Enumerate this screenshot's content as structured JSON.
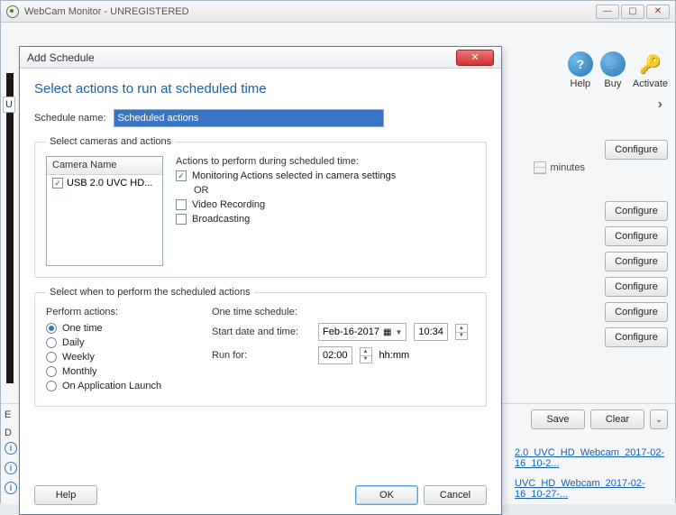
{
  "window": {
    "title": "WebCam Monitor - UNREGISTERED"
  },
  "toolbar": {
    "help": "Help",
    "buy": "Buy",
    "activate": "Activate"
  },
  "background": {
    "minutes_label": "minutes",
    "configure_label": "Configure",
    "save_label": "Save",
    "clear_label": "Clear",
    "file_link_1": "2.0_UVC_HD_Webcam_2017-02-16_10-2...",
    "file_link_2": "UVC_HD_Webcam_2017-02-16_10-27-...",
    "left_E": "E",
    "left_D": "D",
    "left_U": "U"
  },
  "modal": {
    "title": "Add Schedule",
    "heading": "Select actions to run at scheduled time",
    "schedule_name_label": "Schedule name:",
    "schedule_name_value": "Scheduled actions",
    "group1_legend": "Select cameras and actions",
    "camera_header": "Camera Name",
    "camera_item": "USB 2.0 UVC HD...",
    "actions_label": "Actions to perform during scheduled time:",
    "action_monitoring": "Monitoring Actions selected in camera settings",
    "or_text": "OR",
    "action_video": "Video Recording",
    "action_broadcast": "Broadcasting",
    "group2_legend": "Select when to perform the scheduled actions",
    "perform_label": "Perform actions:",
    "opt_onetime": "One time",
    "opt_daily": "Daily",
    "opt_weekly": "Weekly",
    "opt_monthly": "Monthly",
    "opt_launch": "On Application Launch",
    "ots_label": "One time schedule:",
    "start_label": "Start date and time:",
    "start_date": "Feb-16-2017",
    "start_time": "10:34",
    "runfor_label": "Run for:",
    "runfor_value": "02:00",
    "runfor_unit": "hh:mm",
    "help_btn": "Help",
    "ok_btn": "OK",
    "cancel_btn": "Cancel"
  }
}
